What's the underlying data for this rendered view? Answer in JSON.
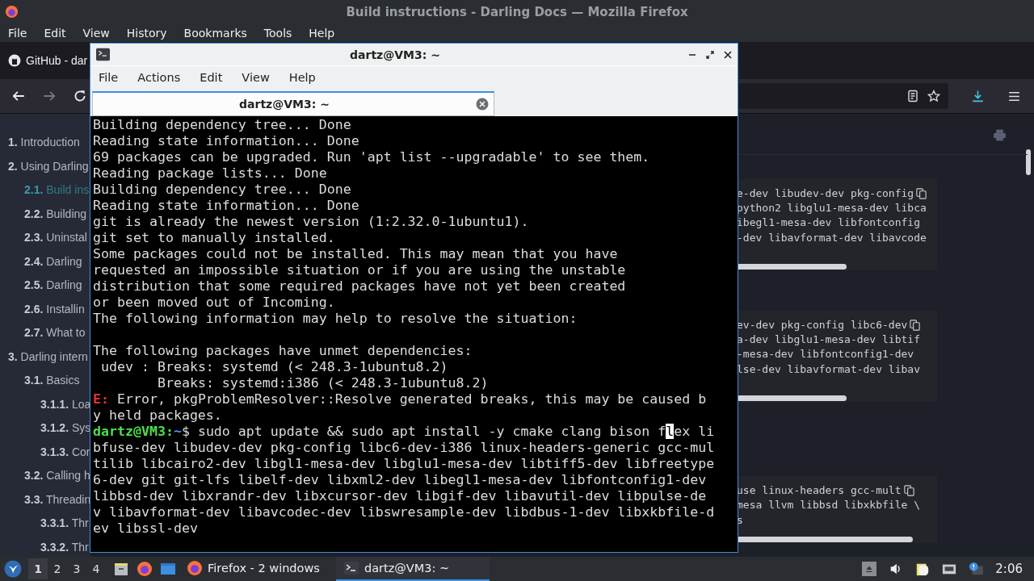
{
  "window": {
    "title": "Build instructions - Darling Docs — Mozilla Firefox"
  },
  "menu": [
    "File",
    "Edit",
    "View",
    "History",
    "Bookmarks",
    "Tools",
    "Help"
  ],
  "tabs": [
    {
      "label": "GitHub - dar",
      "selected": false
    }
  ],
  "nav_buttons": [
    {
      "kind": "back",
      "disabled": false
    },
    {
      "kind": "forward",
      "disabled": true
    },
    {
      "kind": "reload",
      "disabled": false
    }
  ],
  "toolbar_icons": [
    {
      "kind": "reader"
    },
    {
      "kind": "bookmark"
    },
    {
      "kind": "download"
    },
    {
      "kind": "menu"
    }
  ],
  "sidebar": {
    "items": [
      {
        "number": "1.",
        "title": "Introduction",
        "selected": false
      },
      {
        "number": "2.",
        "title": "Using Darling",
        "selected": false,
        "children": [
          {
            "number": "2.1.",
            "title": "Build ins",
            "selected": true
          },
          {
            "number": "2.2.",
            "title": "Building",
            "selected": false
          },
          {
            "number": "2.3.",
            "title": "Uninstal",
            "selected": false
          },
          {
            "number": "2.4.",
            "title": "Darling",
            "selected": false
          },
          {
            "number": "2.5.",
            "title": "Darling",
            "selected": false
          },
          {
            "number": "2.6.",
            "title": "Installin",
            "selected": false
          },
          {
            "number": "2.7.",
            "title": "What to",
            "selected": false
          }
        ]
      },
      {
        "number": "3.",
        "title": "Darling intern",
        "selected": false,
        "children": [
          {
            "number": "3.1.",
            "title": "Basics",
            "selected": false,
            "children": [
              {
                "number": "3.1.1.",
                "title": "Loa",
                "selected": false
              },
              {
                "number": "3.1.2.",
                "title": "Sys",
                "selected": false
              },
              {
                "number": "3.1.3.",
                "title": "Cor",
                "selected": false
              }
            ]
          },
          {
            "number": "3.2.",
            "title": "Calling h",
            "selected": false
          },
          {
            "number": "3.3.",
            "title": "Threadin",
            "selected": false,
            "children": [
              {
                "number": "3.3.1.",
                "title": "Thr",
                "selected": false
              },
              {
                "number": "3.3.2.",
                "title": "Thr",
                "selected": false
              }
            ]
          }
        ]
      }
    ]
  },
  "code_blocks": [
    {
      "lines": [
        "e-dev libudev-dev pkg-config",
        "python2 libglu1-mesa-dev libca",
        "ibegl1-mesa-dev libfontconfig",
        "-dev libavformat-dev libavcode"
      ],
      "level": 0.55
    },
    {
      "lines": [
        "ev-dev pkg-config libc6-dev",
        "a-dev libglu1-mesa-dev libtif",
        "-mesa-dev libfontconfig1-dev",
        "lse-dev libavformat-dev libav"
      ],
      "level": 0.55
    },
    {
      "lines": [
        "use linux-headers gcc-mult",
        "mesa llvm libbsd libxkbfile \\",
        "s"
      ],
      "level": 0.88
    }
  ],
  "terminal": {
    "title": "dartz@VM3: ~",
    "menu": [
      "File",
      "Actions",
      "Edit",
      "View",
      "Help"
    ],
    "tab": {
      "label": "dartz@VM3: ~"
    },
    "lines": [
      {
        "kind": "text",
        "text": "Building dependency tree... Done"
      },
      {
        "kind": "text",
        "text": "Reading state information... Done"
      },
      {
        "kind": "text",
        "text": "69 packages can be upgraded. Run 'apt list --upgradable' to see them."
      },
      {
        "kind": "text",
        "text": "Reading package lists... Done"
      },
      {
        "kind": "text",
        "text": "Building dependency tree... Done"
      },
      {
        "kind": "text",
        "text": "Reading state information... Done"
      },
      {
        "kind": "text",
        "text": "git is already the newest version (1:2.32.0-1ubuntu1)."
      },
      {
        "kind": "text",
        "text": "git set to manually installed."
      },
      {
        "kind": "text",
        "text": "Some packages could not be installed. This may mean that you have"
      },
      {
        "kind": "text",
        "text": "requested an impossible situation or if you are using the unstable"
      },
      {
        "kind": "text",
        "text": "distribution that some required packages have not yet been created"
      },
      {
        "kind": "text",
        "text": "or been moved out of Incoming."
      },
      {
        "kind": "text",
        "text": "The following information may help to resolve the situation:"
      },
      {
        "kind": "blank"
      },
      {
        "kind": "text",
        "text": "The following packages have unmet dependencies:"
      },
      {
        "kind": "text",
        "text": " udev : Breaks: systemd (< 248.3-1ubuntu8.2)"
      },
      {
        "kind": "text",
        "text": "        Breaks: systemd:i386 (< 248.3-1ubuntu8.2)"
      },
      {
        "kind": "error",
        "prefix": "E:",
        "text": " Error, pkgProblemResolver::Resolve generated breaks, this may be caused by held packages."
      },
      {
        "kind": "prompt",
        "user": "dartz@VM3:",
        "path": "~",
        "symbol": "$ ",
        "text": "sudo apt update && sudo apt install -y cmake clang bison f",
        "cursor": "l",
        "rest": "ex libfuse-dev libudev-dev pkg-config libc6-dev-i386 linux-headers-generic gcc-multilib libcairo2-dev libgl1-mesa-dev libglu1-mesa-dev libtiff5-dev libfreetype6-dev git git-lfs libelf-dev libxml2-dev libegl1-mesa-dev libfontconfig1-dev libbsd-dev libxrandr-dev libxcursor-dev libgif-dev libavutil-dev libpulse-dev libavformat-dev libavcodec-dev libswresample-dev libdbus-1-dev libxkbfile-dev libssl-dev"
      }
    ]
  },
  "taskbar": {
    "workspaces": [
      {
        "label": "1",
        "selected": true
      },
      {
        "label": "2",
        "selected": false
      },
      {
        "label": "3",
        "selected": false
      },
      {
        "label": "4",
        "selected": false
      }
    ],
    "launchers": [
      {
        "kind": "files"
      },
      {
        "kind": "browser"
      },
      {
        "kind": "desktop"
      }
    ],
    "tasks": [
      {
        "kind": "browser",
        "label": "Firefox - 2 windows",
        "selected": false
      },
      {
        "kind": "terminal",
        "label": "dartz@VM3: ~",
        "selected": true
      }
    ],
    "tray": [
      {
        "kind": "eject"
      },
      {
        "kind": "volume"
      },
      {
        "kind": "clipboard"
      },
      {
        "kind": "network"
      },
      {
        "kind": "notification"
      }
    ],
    "clock": "2:06"
  }
}
